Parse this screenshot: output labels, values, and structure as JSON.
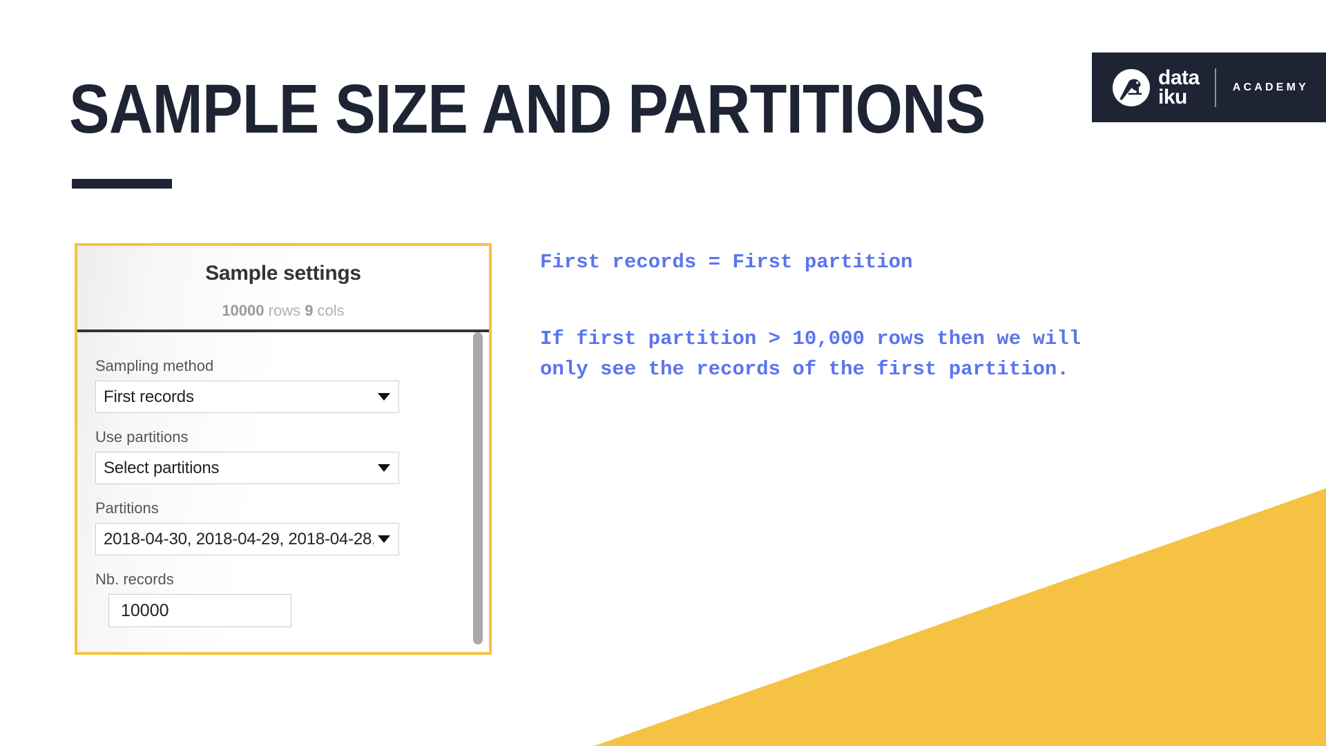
{
  "slide": {
    "title": "SAMPLE SIZE AND PARTITIONS",
    "accent_yellow": "#F6C244",
    "dark_navy": "#1E2433",
    "note_blue": "#5B74EE"
  },
  "logo": {
    "bird_icon": "dataiku-bird-icon",
    "word_line1": "data",
    "word_line2": "iku",
    "academy": "ACADEMY"
  },
  "sample_panel": {
    "title": "Sample settings",
    "stats": {
      "rows_value": "10000",
      "rows_label": " rows ",
      "cols_value": "9",
      "cols_label": " cols"
    },
    "fields": [
      {
        "label": "Sampling method",
        "type": "select",
        "value": "First records"
      },
      {
        "label": "Use partitions",
        "type": "select",
        "value": "Select partitions"
      },
      {
        "label": "Partitions",
        "type": "select",
        "value": "2018-04-30, 2018-04-29, 2018-04-28,"
      },
      {
        "label": "Nb. records",
        "type": "number",
        "value": "10000"
      }
    ]
  },
  "notes": {
    "line1": "First records = First partition",
    "line2": "If first partition > 10,000 rows then we will",
    "line3": "only see the records of the first partition."
  }
}
